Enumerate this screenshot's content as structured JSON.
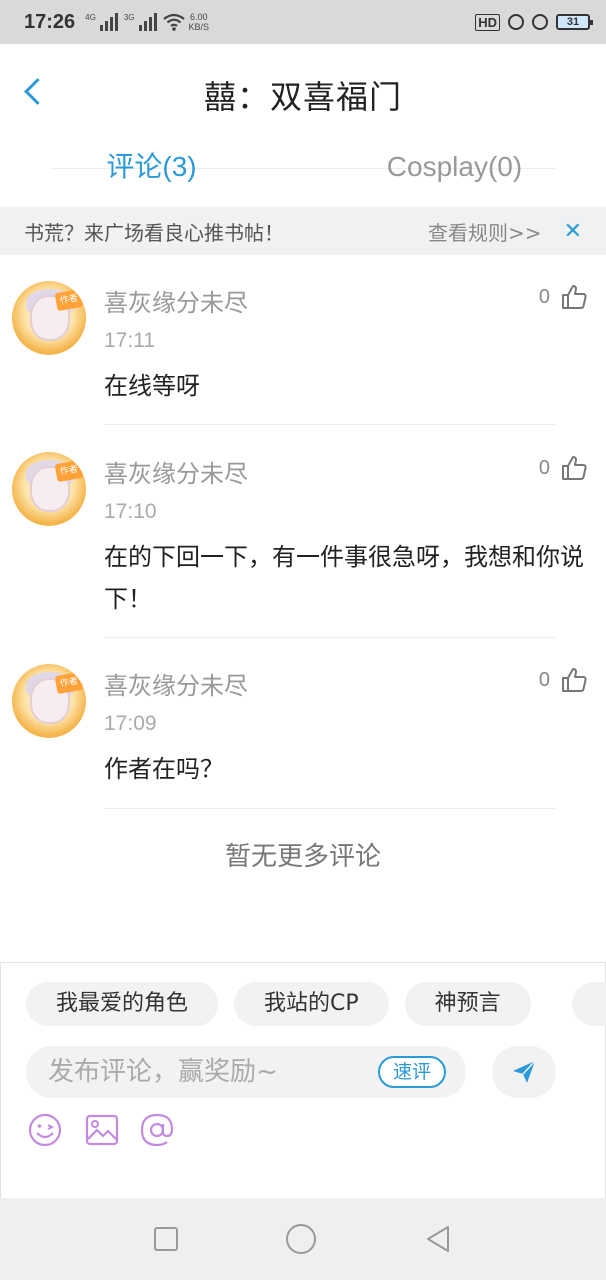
{
  "status_bar": {
    "time": "17:26",
    "signal1": "4G",
    "signal2": "3G",
    "net_speed_value": "6.00",
    "net_speed_unit": "KB/S",
    "hd": "HD",
    "battery": "31"
  },
  "header": {
    "title": "囍：双喜福门"
  },
  "tabs": [
    {
      "label": "评论(3)",
      "active": true
    },
    {
      "label": "Cosplay(0)",
      "active": false
    }
  ],
  "notice": {
    "text": "书荒？来广场看良心推书帖！",
    "link": "查看规则>>",
    "close": "✕"
  },
  "comments": [
    {
      "author": "喜灰缘分未尽",
      "time": "17:11",
      "text": "在线等呀",
      "likes": "0",
      "badge": "作者"
    },
    {
      "author": "喜灰缘分未尽",
      "time": "17:10",
      "text": "在的下回一下，有一件事很急呀，我想和你说下！",
      "likes": "0",
      "badge": "作者"
    },
    {
      "author": "喜灰缘分未尽",
      "time": "17:09",
      "text": "作者在吗？",
      "likes": "0",
      "badge": "作者"
    }
  ],
  "no_more": "暂无更多评论",
  "quick_tags": [
    "我最爱的角色",
    "我站的CP",
    "神预言"
  ],
  "composer": {
    "placeholder": "发布评论，赢奖励~",
    "quick_label": "速评"
  },
  "icons": {
    "accent": "#2a9ad9",
    "tool_color": "#c38be0",
    "tools": [
      "emoji-icon",
      "image-icon",
      "at-icon"
    ]
  }
}
